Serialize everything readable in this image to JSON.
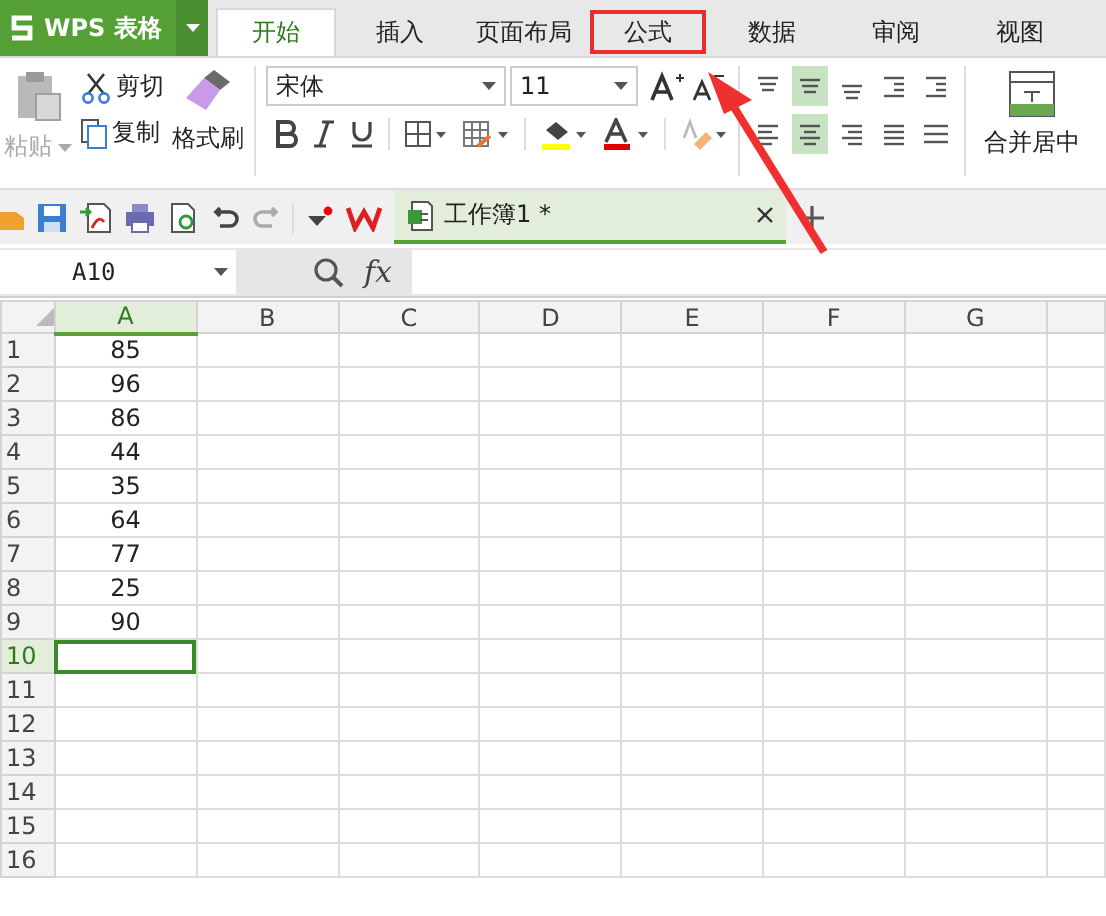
{
  "app": {
    "name": "WPS 表格"
  },
  "tabs": [
    {
      "label": "开始",
      "selected": true,
      "highlighted": false
    },
    {
      "label": "插入",
      "selected": false,
      "highlighted": false
    },
    {
      "label": "页面布局",
      "selected": false,
      "highlighted": false
    },
    {
      "label": "公式",
      "selected": false,
      "highlighted": true
    },
    {
      "label": "数据",
      "selected": false,
      "highlighted": false
    },
    {
      "label": "审阅",
      "selected": false,
      "highlighted": false
    },
    {
      "label": "视图",
      "selected": false,
      "highlighted": false
    }
  ],
  "clipboard": {
    "paste": {
      "label": "粘贴",
      "disabled": true
    },
    "cut": "剪切",
    "copy": "复制",
    "format_painter": "格式刷"
  },
  "font": {
    "family": "宋体",
    "size": "11"
  },
  "align_top": [
    {
      "kind": "top",
      "selected": false
    },
    {
      "kind": "middle",
      "selected": true
    },
    {
      "kind": "bottom",
      "selected": false
    },
    {
      "kind": "outdent",
      "selected": false
    },
    {
      "kind": "indent",
      "selected": false
    }
  ],
  "align_bottom": [
    {
      "kind": "left",
      "selected": false
    },
    {
      "kind": "center",
      "selected": true
    },
    {
      "kind": "right",
      "selected": false
    },
    {
      "kind": "justify",
      "selected": false
    },
    {
      "kind": "distribute",
      "selected": false
    }
  ],
  "merge": "合并居中",
  "doc_tab": {
    "title": "工作簿1 *",
    "selected": true
  },
  "formula_bar": {
    "name_box": "A10",
    "fx": "fx"
  },
  "columns": [
    {
      "label": "A",
      "selected": true
    },
    {
      "label": "B",
      "selected": false
    },
    {
      "label": "C",
      "selected": false
    },
    {
      "label": "D",
      "selected": false
    },
    {
      "label": "E",
      "selected": false
    },
    {
      "label": "F",
      "selected": false
    },
    {
      "label": "G",
      "selected": false
    }
  ],
  "rows": [
    {
      "label": "1",
      "value": "85",
      "selected": false
    },
    {
      "label": "2",
      "value": "96",
      "selected": false
    },
    {
      "label": "3",
      "value": "86",
      "selected": false
    },
    {
      "label": "4",
      "value": "44",
      "selected": false
    },
    {
      "label": "5",
      "value": "35",
      "selected": false
    },
    {
      "label": "6",
      "value": "64",
      "selected": false
    },
    {
      "label": "7",
      "value": "77",
      "selected": false
    },
    {
      "label": "8",
      "value": "25",
      "selected": false
    },
    {
      "label": "9",
      "value": "90",
      "selected": false
    },
    {
      "label": "10",
      "selected": true
    },
    {
      "label": "11",
      "selected": false
    },
    {
      "label": "12",
      "selected": false
    },
    {
      "label": "13",
      "selected": false
    },
    {
      "label": "14",
      "selected": false
    },
    {
      "label": "15",
      "selected": false
    },
    {
      "label": "16",
      "selected": false
    }
  ]
}
